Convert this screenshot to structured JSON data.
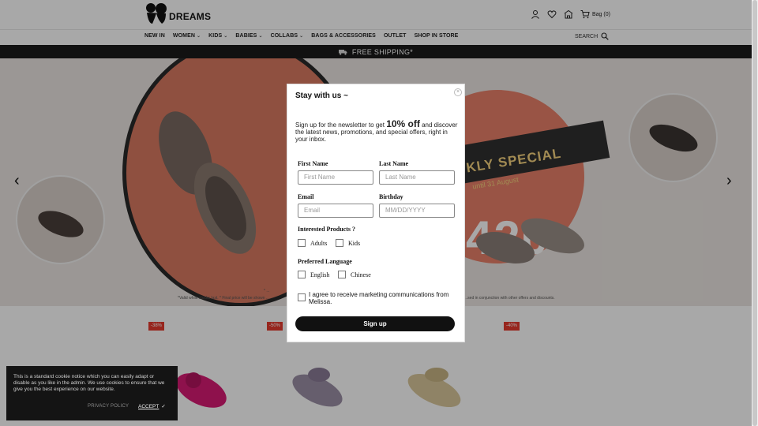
{
  "brand": {
    "name": "DREAMS"
  },
  "header": {
    "bag_label": "Bag (0)",
    "icons": [
      "user-icon",
      "heart-icon",
      "store-icon",
      "cart-icon"
    ]
  },
  "nav": {
    "items": [
      {
        "label": "NEW IN",
        "dropdown": false
      },
      {
        "label": "WOMEN",
        "dropdown": true
      },
      {
        "label": "KIDS",
        "dropdown": true
      },
      {
        "label": "BABIES",
        "dropdown": true
      },
      {
        "label": "COLLABS",
        "dropdown": true
      },
      {
        "label": "BAGS & ACCESSORIES",
        "dropdown": false
      },
      {
        "label": "OUTLET",
        "dropdown": false
      },
      {
        "label": "SHOP IN STORE",
        "dropdown": false
      }
    ],
    "search_label": "SEARCH"
  },
  "promo_bar": {
    "text": "FREE SHIPPING*"
  },
  "hero": {
    "special": "KLY SPECIAL",
    "until": "until 31 August",
    "price": "420",
    "fine_print_1": "* ...",
    "fine_print_2": "*Valid while stocks last.  * Final price will be shown ...",
    "fine_print_3": "...sed in conjunction with other offers and discounts."
  },
  "products": {
    "badges": [
      "-38%",
      "-50%",
      "-40%"
    ]
  },
  "modal": {
    "title": "Stay with us ~",
    "desc_pre": "Sign up for the newsletter to get ",
    "desc_big": "10% off",
    "desc_post": " and discover the latest news, promotions, and special offers, right in your inbox.",
    "first_name_label": "First Name",
    "first_name_placeholder": "First Name",
    "last_name_label": "Last Name",
    "last_name_placeholder": "Last Name",
    "email_label": "Email",
    "email_placeholder": "Email",
    "birthday_label": "Birthday",
    "birthday_placeholder": "MM/DD/YYYY",
    "interested_label": "Interested Products ?",
    "interested_options": [
      "Adults",
      "Kids"
    ],
    "language_label": "Preferred Language",
    "language_options": [
      "English",
      "Chinese"
    ],
    "consent": "I agree to receive marketing communications from Melissa.",
    "signup_label": "Sign up"
  },
  "cookie": {
    "text": "This is a standard cookie notice which you can easily adapt or disable as you like in the admin. We use cookies to ensure that we give you the best experience on our website.",
    "policy_label": "PRIVACY POLICY",
    "accept_label": "ACCEPT"
  },
  "colors": {
    "accent": "#e63b2e",
    "dark": "#111111",
    "hero_bg": "#ece6e2",
    "coral": "#e8806a"
  }
}
